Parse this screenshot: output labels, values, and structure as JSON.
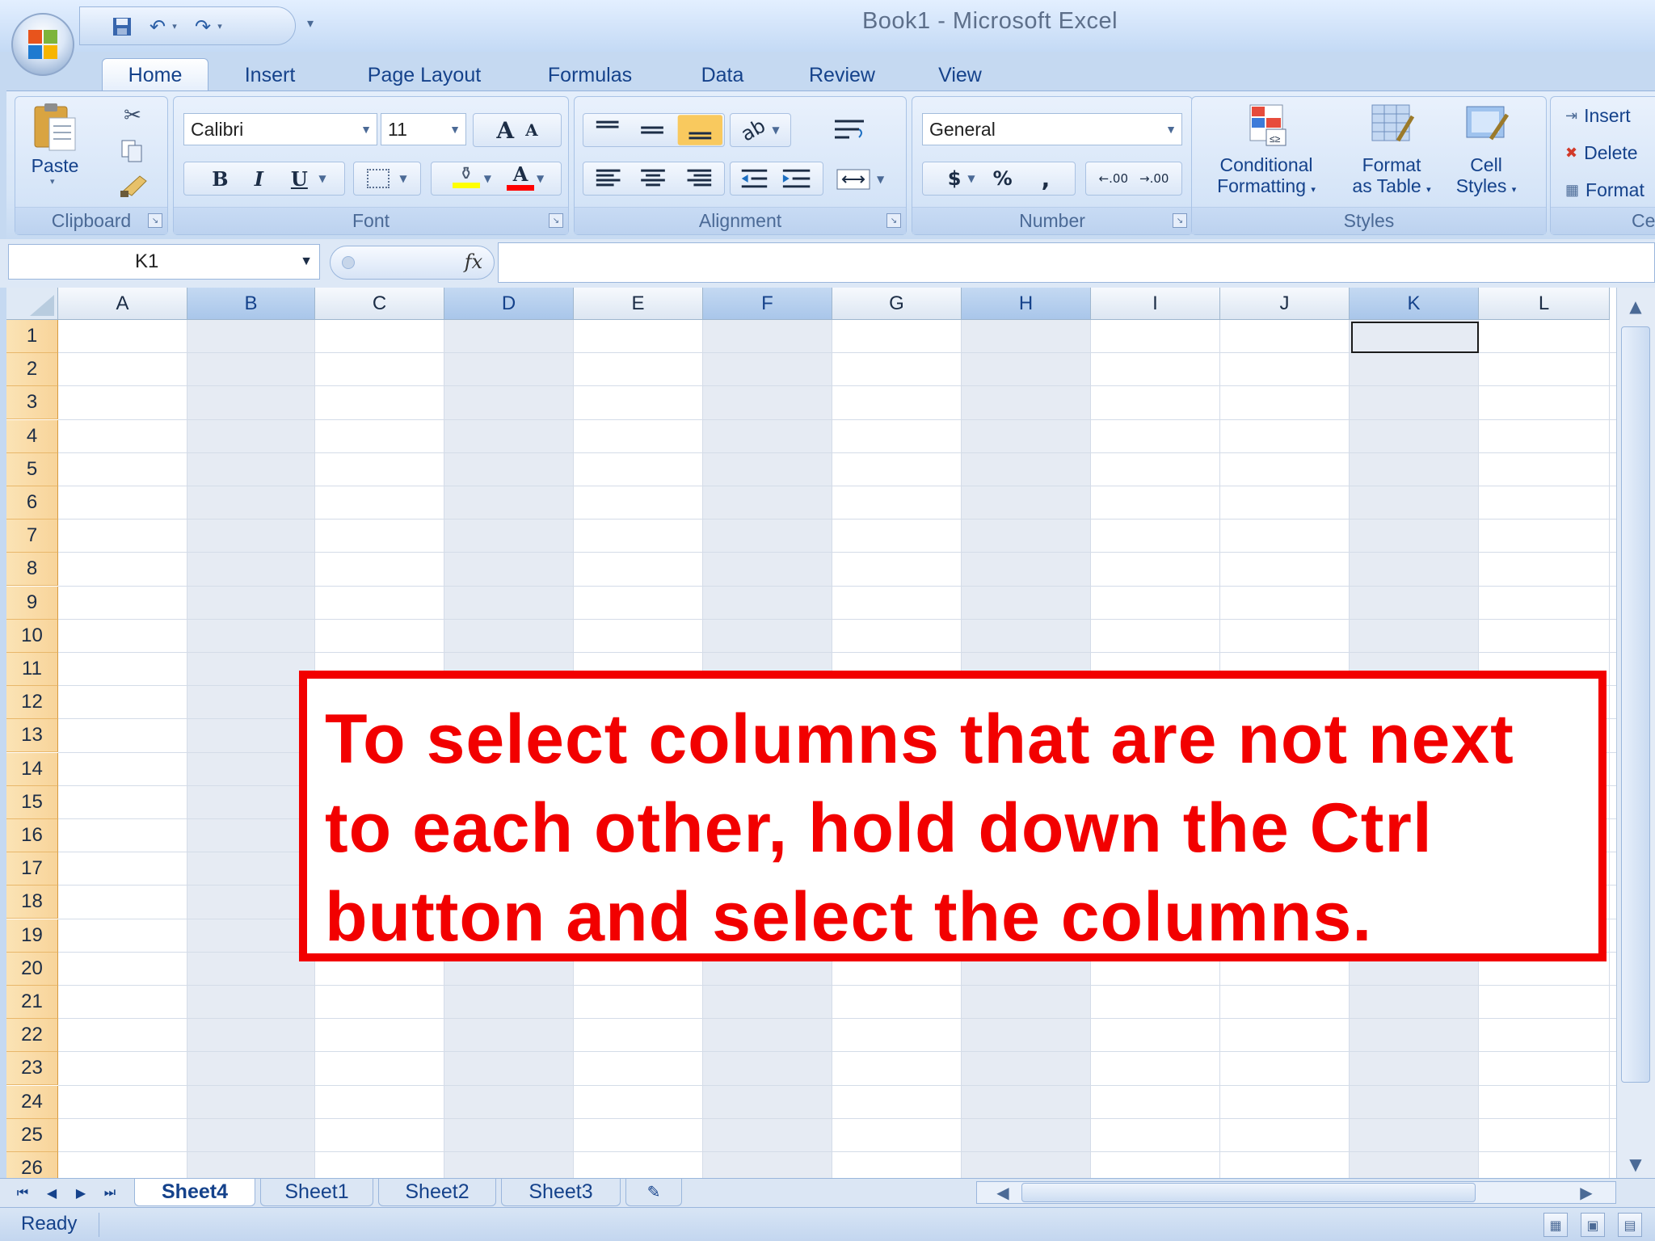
{
  "window": {
    "title": "Book1 - Microsoft Excel"
  },
  "ribbon_tabs": [
    "Home",
    "Insert",
    "Page Layout",
    "Formulas",
    "Data",
    "Review",
    "View"
  ],
  "ribbon": {
    "clipboard": {
      "label": "Clipboard",
      "paste": "Paste"
    },
    "font": {
      "label": "Font",
      "name": "Calibri",
      "size": "11",
      "bold": "B",
      "italic": "I",
      "underline": "U",
      "grow": "A",
      "shrink": "A",
      "color_glyph": "A"
    },
    "alignment": {
      "label": "Alignment"
    },
    "number": {
      "label": "Number",
      "format": "General",
      "currency": "$",
      "percent": "%",
      "comma": ",",
      "inc_decimal": ".00",
      "dec_decimal": ".00"
    },
    "styles": {
      "label": "Styles",
      "conditional_1": "Conditional",
      "conditional_2": "Formatting",
      "format_table_1": "Format",
      "format_table_2": "as Table",
      "cell_styles_1": "Cell",
      "cell_styles_2": "Styles"
    },
    "cells": {
      "label": "Cells",
      "insert": "Insert",
      "delete": "Delete",
      "format": "Format"
    }
  },
  "formula_bar": {
    "name_box": "K1",
    "fx": "fx",
    "value": ""
  },
  "grid": {
    "columns": [
      "A",
      "B",
      "C",
      "D",
      "E",
      "F",
      "G",
      "H",
      "I",
      "J",
      "K",
      "L"
    ],
    "selected_columns": [
      "B",
      "D",
      "F",
      "H",
      "K"
    ],
    "rows": [
      "1",
      "2",
      "3",
      "4",
      "5",
      "6",
      "7",
      "8",
      "9",
      "10",
      "11",
      "12",
      "13",
      "14",
      "15",
      "16",
      "17",
      "18",
      "19",
      "20",
      "21",
      "22",
      "23",
      "24",
      "25",
      "26"
    ],
    "active_cell": "K1"
  },
  "sheets": {
    "tabs": [
      "Sheet4",
      "Sheet1",
      "Sheet2",
      "Sheet3"
    ],
    "active": "Sheet4"
  },
  "status": {
    "text": "Ready"
  },
  "callout": {
    "text": "To select columns that are not next to each other, hold down the Ctrl button and select the columns."
  },
  "colors": {
    "accent": "#15428b",
    "callout": "#f20000",
    "selected_header": "#a9c6ea",
    "selected_column": "#e6ebf3"
  }
}
